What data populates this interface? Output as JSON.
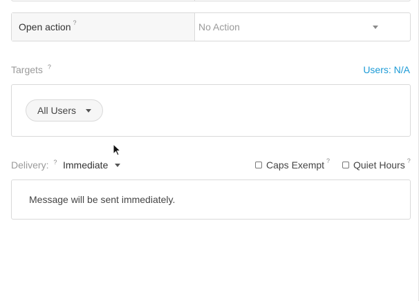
{
  "open_action": {
    "label": "Open action",
    "help": "?",
    "value": "No Action"
  },
  "targets": {
    "label": "Targets",
    "help": "?",
    "users_link": "Users: N/A",
    "audience_pill": "All Users"
  },
  "delivery": {
    "label": "Delivery:",
    "help": "?",
    "value": "Immediate",
    "caps_exempt": {
      "label": "Caps Exempt",
      "help": "?",
      "checked": false
    },
    "quiet_hours": {
      "label": "Quiet Hours",
      "help": "?",
      "checked": false
    },
    "message": "Message will be sent immediately."
  },
  "colors": {
    "link": "#1b9ad6",
    "border": "#d9d9d9",
    "muted_text": "#9a9a9a"
  },
  "icons": {
    "dropdown": "caret-down-icon",
    "help": "question-mark-icon",
    "cursor": "mouse-pointer-icon"
  }
}
